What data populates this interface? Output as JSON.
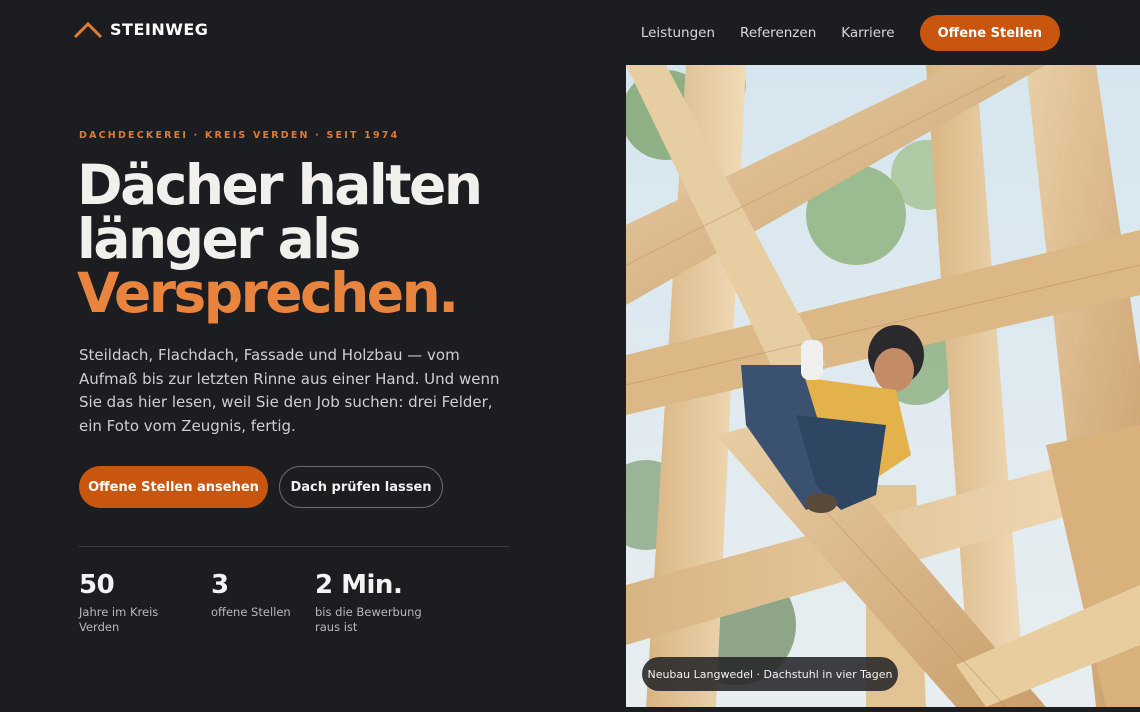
{
  "brand": {
    "name": "STEINWEG",
    "accent": "#e07b34"
  },
  "nav": {
    "links": [
      "Leistungen",
      "Referenzen",
      "Karriere"
    ],
    "cta": "Offene Stellen"
  },
  "hero": {
    "eyebrow": "DACHDECKEREI · KREIS VERDEN · SEIT 1974",
    "headline_line1": "Dächer halten",
    "headline_line2": "länger als",
    "headline_accent": "Versprechen.",
    "lead": "Steildach, Flachdach, Fassade und Holzbau — vom Aufmaß bis zur letzten Rinne aus einer Hand. Und wenn Sie das hier lesen, weil Sie den Job suchen: drei Felder, ein Foto vom Zeugnis, fertig.",
    "primary_button": "Offene Stellen ansehen",
    "secondary_button": "Dach prüfen lassen"
  },
  "stats": [
    {
      "value": "50",
      "label": "Jahre im Kreis Verden"
    },
    {
      "value": "3",
      "label": "offene Stellen"
    },
    {
      "value": "2 Min.",
      "label": "bis die Bewerbung raus ist"
    }
  ],
  "photo": {
    "caption": "Neubau Langwedel · Dachstuhl in vier Tagen"
  },
  "colors": {
    "background": "#1b1d21",
    "primary": "#c8560f",
    "accent_text": "#e9843e"
  }
}
